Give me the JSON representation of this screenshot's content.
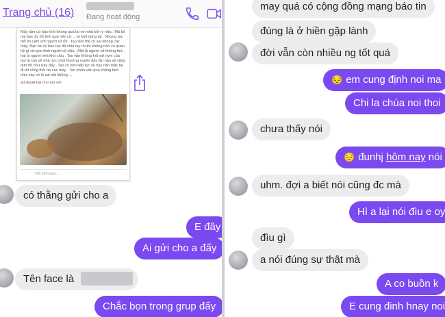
{
  "left_panel": {
    "header": {
      "title": "Trang chủ (16)",
      "status": "Đang hoạt động",
      "call_icon": "phone-icon",
      "video_icon": "video-icon"
    },
    "shared_screenshot": {
      "post_text": "Mấy tấm cứ bảo thôi không quá lại với nhà bỏn ý nữa . Mà bố mẹ bạn ấy tốt tính quá nên cứ ... bị khổ dùng lại . Nhưng tao hết tin cảm với người cũ rồi . Tao làm thế cũ sai không các mày. Bạn bè cũ bảo tao đã chia tay rồi thì không nên có quan hệ gì với gia đình người cũ nữa . Một là người cũ không thíc , hai là người nhà khó chịu . Tao vẫn không hỏi với nym của tao là còn về nhà nyc chơi thường xuyên đấy lần nào về cũng tâm tốt như này đấy . Tao có nên tiếp tục về hay nên mặc kệ đi tốt cũng thôi hà các mày . Tao phân vân quá không biết như này có là sai trái không ...",
      "approval_note": "ad duyệt bài cho em với",
      "comment_placeholder": "Viết bình luận..."
    },
    "messages": [
      {
        "text": "có thằng gửi cho a",
        "side": "in"
      },
      {
        "text": "E đây",
        "side": "out"
      },
      {
        "text": "Ai gửi cho a đấy",
        "side": "out"
      },
      {
        "text": "Tên face là",
        "side": "in"
      },
      {
        "text": "Chắc bọn trong grup đấy",
        "side": "out"
      }
    ]
  },
  "right_panel": {
    "messages": [
      {
        "text": "may quá có cộng đồng mạng báo tin",
        "side": "in"
      },
      {
        "text": "đúng là ở hiền gặp lành",
        "side": "in"
      },
      {
        "text": "đời vẫn còn nhiều ng tốt quá",
        "side": "in"
      },
      {
        "text": "em cung định noi ma",
        "side": "out",
        "emoji": "😔"
      },
      {
        "text": "Chi la chúa noi thoi",
        "side": "out"
      },
      {
        "text": "chưa thấy nói",
        "side": "in"
      },
      {
        "text_before": "đunhj ",
        "text_link": "hôm nay",
        "text_after": " nói",
        "side": "out",
        "emoji": "😔"
      },
      {
        "text": "uhm. đợi a biết nói cũng đc mà",
        "side": "in"
      },
      {
        "text": "Hì a lại nói đìu e oy",
        "side": "out"
      },
      {
        "text": "đìu gì",
        "side": "in"
      },
      {
        "text": "a nói đúng sự thật mà",
        "side": "in"
      },
      {
        "text": "A co buồn k",
        "side": "out"
      },
      {
        "text": "E cung đinh hnay noi",
        "side": "out"
      }
    ]
  },
  "colors": {
    "outgoing_bubble": "#7b49f0",
    "incoming_bubble": "#ececee",
    "header_title": "#7b49f0"
  }
}
